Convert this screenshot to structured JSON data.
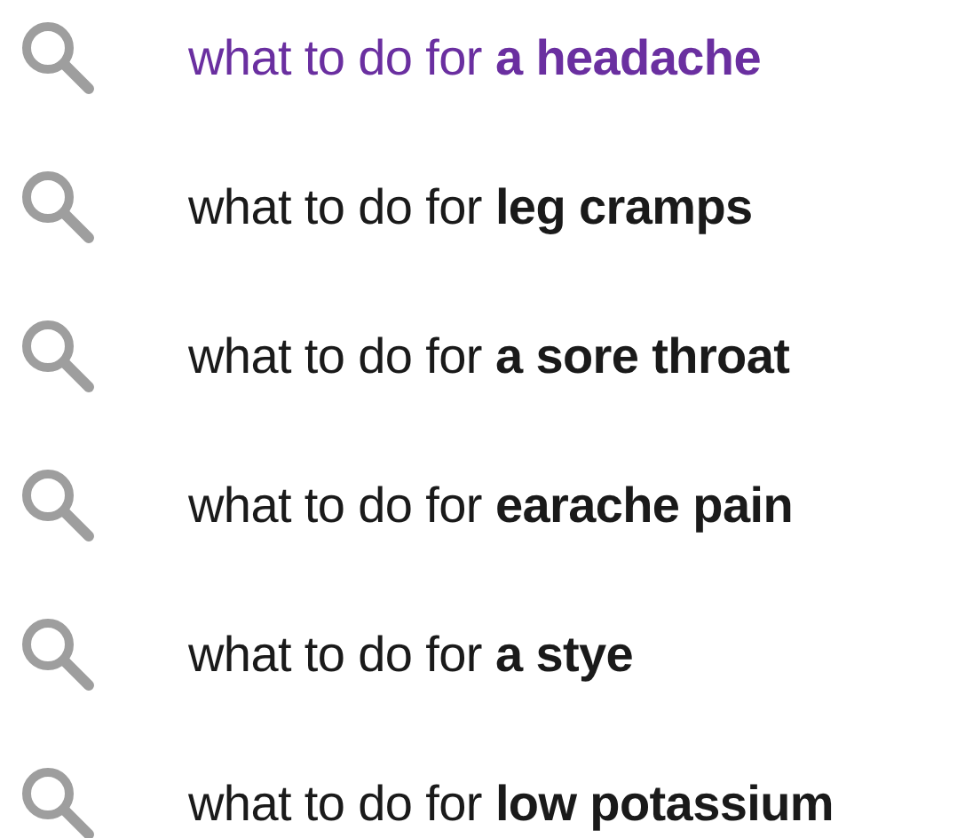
{
  "suggestions": [
    {
      "text": "what to do for **a headache**",
      "visited": true
    },
    {
      "text": "what to do for **leg cramps**",
      "visited": false
    },
    {
      "text": "what to do for **a sore throat**",
      "visited": false
    },
    {
      "text": "what to do for **earache pain**",
      "visited": false
    },
    {
      "text": "what to do for **a stye**",
      "visited": false
    },
    {
      "text": "what to do for **low potassium**",
      "visited": false
    }
  ]
}
